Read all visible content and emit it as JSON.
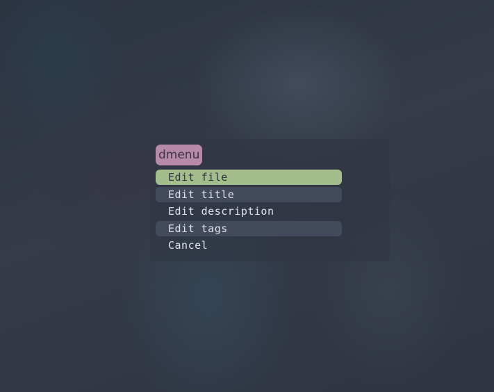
{
  "dmenu": {
    "prompt": "dmenu",
    "items": [
      {
        "label": "Edit file",
        "state": "selected"
      },
      {
        "label": "Edit title",
        "state": "alt"
      },
      {
        "label": "Edit description",
        "state": "normal"
      },
      {
        "label": "Edit tags",
        "state": "alt"
      },
      {
        "label": "Cancel",
        "state": "normal"
      }
    ]
  },
  "colors": {
    "selected_bg": "#a3be8c",
    "alt_row_bg": "#434a5c",
    "prompt_bg": "#b88aa9",
    "text": "#dfe3ea"
  }
}
